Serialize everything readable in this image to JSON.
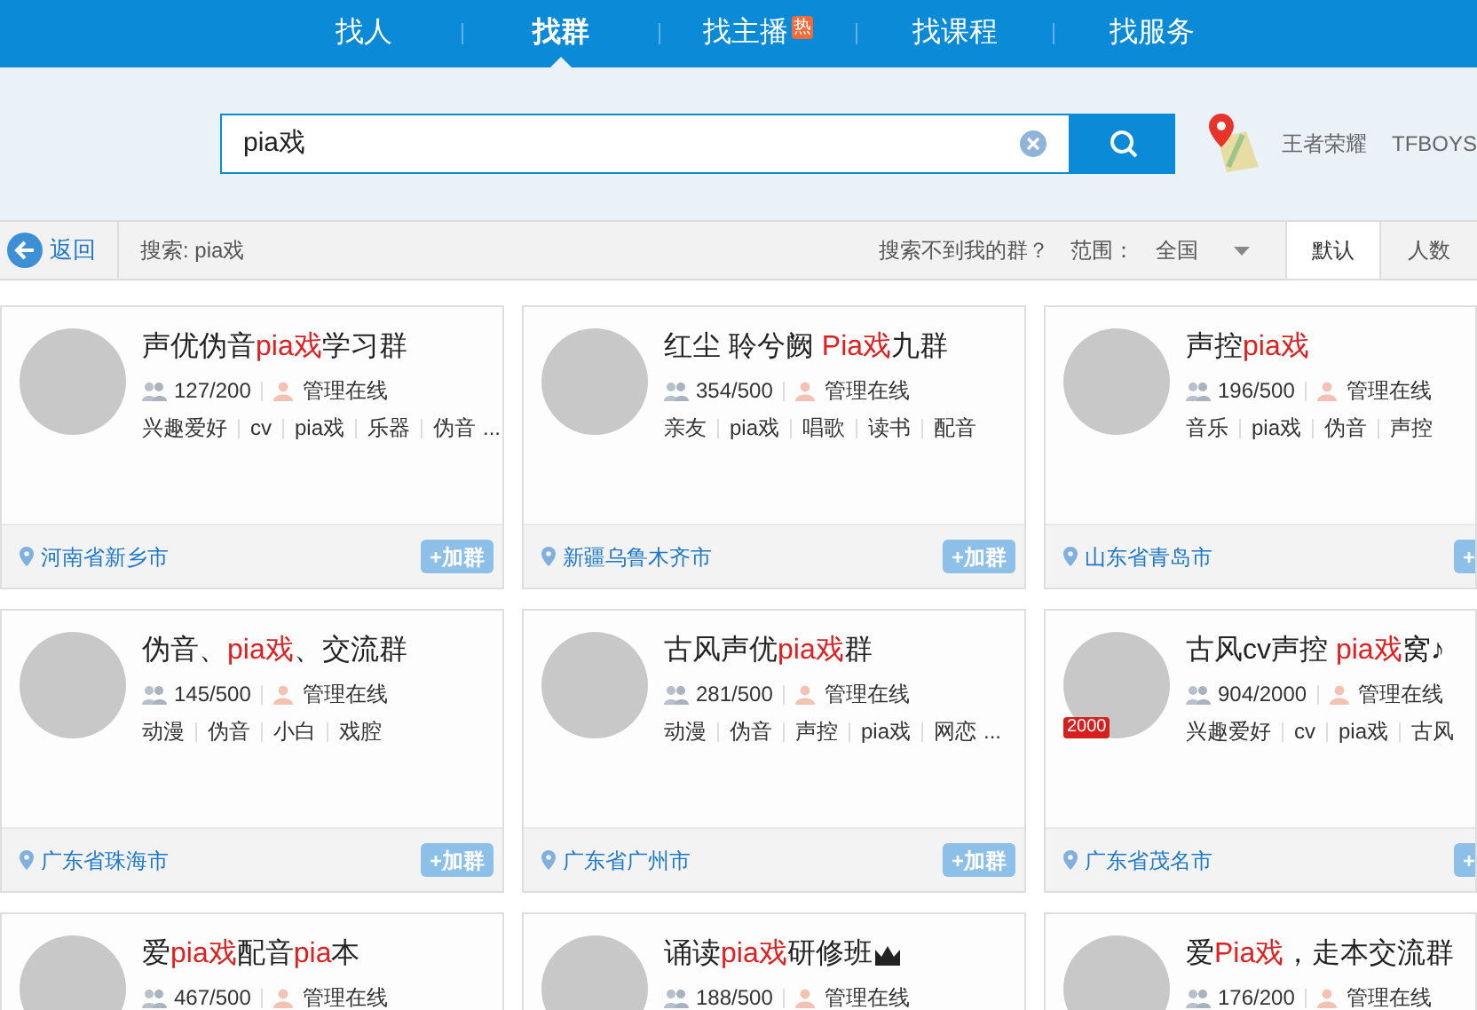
{
  "nav": {
    "tabs": [
      {
        "label": "找人",
        "selected": false
      },
      {
        "label": "找群",
        "selected": true
      },
      {
        "label": "找主播",
        "selected": false,
        "badge": "热"
      },
      {
        "label": "找课程",
        "selected": false
      },
      {
        "label": "找服务",
        "selected": false
      }
    ]
  },
  "search": {
    "value": "pia戏",
    "hot_words": [
      "王者荣耀",
      "TFBOYS"
    ]
  },
  "toolbar": {
    "back": "返回",
    "query": "搜索: pia戏",
    "help": "搜索不到我的群？",
    "range_label": "范围：",
    "range_value": "全国",
    "sort_tabs": [
      {
        "label": "默认",
        "selected": true
      },
      {
        "label": "人数",
        "selected": false
      }
    ]
  },
  "groups": [
    {
      "name": [
        {
          "text": "声优伪音",
          "highlight": false
        },
        {
          "text": "pia戏",
          "highlight": true
        },
        {
          "text": "学习群",
          "highlight": false
        }
      ],
      "members": "127/200",
      "admin": "管理在线",
      "tags": [
        "兴趣爱好",
        "cv",
        "pia戏",
        "乐器",
        "伪音"
      ],
      "more": "...",
      "location": "河南省新乡市",
      "join": "+加群"
    },
    {
      "name": [
        {
          "text": "红尘 聆兮阙 ",
          "highlight": false
        },
        {
          "text": "Pia戏",
          "highlight": true
        },
        {
          "text": "九群",
          "highlight": false
        }
      ],
      "members": "354/500",
      "admin": "管理在线",
      "tags": [
        "亲友",
        "pia戏",
        "唱歌",
        "读书",
        "配音"
      ],
      "location": "新疆乌鲁木齐市",
      "join": "+加群"
    },
    {
      "name": [
        {
          "text": "声控",
          "highlight": false
        },
        {
          "text": "pia戏",
          "highlight": true
        }
      ],
      "members": "196/500",
      "admin": "管理在线",
      "tags": [
        "音乐",
        "pia戏",
        "伪音",
        "声控"
      ],
      "location": "山东省青岛市",
      "join": "+"
    },
    {
      "name": [
        {
          "text": "伪音、",
          "highlight": false
        },
        {
          "text": "pia戏",
          "highlight": true
        },
        {
          "text": "、交流群",
          "highlight": false
        }
      ],
      "members": "145/500",
      "admin": "管理在线",
      "tags": [
        "动漫",
        "伪音",
        "小白",
        "戏腔"
      ],
      "location": "广东省珠海市",
      "join": "+加群"
    },
    {
      "name": [
        {
          "text": "古风声优",
          "highlight": false
        },
        {
          "text": "pia戏",
          "highlight": true
        },
        {
          "text": "群",
          "highlight": false
        }
      ],
      "members": "281/500",
      "admin": "管理在线",
      "tags": [
        "动漫",
        "伪音",
        "声控",
        "pia戏",
        "网恋"
      ],
      "more": "...",
      "location": "广东省广州市",
      "join": "+加群"
    },
    {
      "name": [
        {
          "text": "古风cv声控 ",
          "highlight": false
        },
        {
          "text": "pia戏",
          "highlight": true
        },
        {
          "text": "窝♪",
          "highlight": false
        }
      ],
      "avatar_badge": "2000",
      "members": "904/2000",
      "admin": "管理在线",
      "tags": [
        "兴趣爱好",
        "cv",
        "pia戏",
        "古风"
      ],
      "location": "广东省茂名市",
      "join": "+"
    },
    {
      "name": [
        {
          "text": "爱",
          "highlight": false
        },
        {
          "text": "pia戏",
          "highlight": true
        },
        {
          "text": "配音",
          "highlight": false
        },
        {
          "text": "pia",
          "highlight": true
        },
        {
          "text": "本",
          "highlight": false
        }
      ],
      "members": "467/500",
      "admin": "管理在线"
    },
    {
      "name": [
        {
          "text": "诵读",
          "highlight": false
        },
        {
          "text": "pia戏",
          "highlight": true
        },
        {
          "text": "研修班",
          "highlight": false
        }
      ],
      "crown": true,
      "members": "188/500",
      "admin": "管理在线"
    },
    {
      "name": [
        {
          "text": "爱",
          "highlight": false
        },
        {
          "text": "Pia戏",
          "highlight": true
        },
        {
          "text": "，走本交流群",
          "highlight": false
        }
      ],
      "members": "176/200",
      "admin": "管理在线"
    }
  ]
}
